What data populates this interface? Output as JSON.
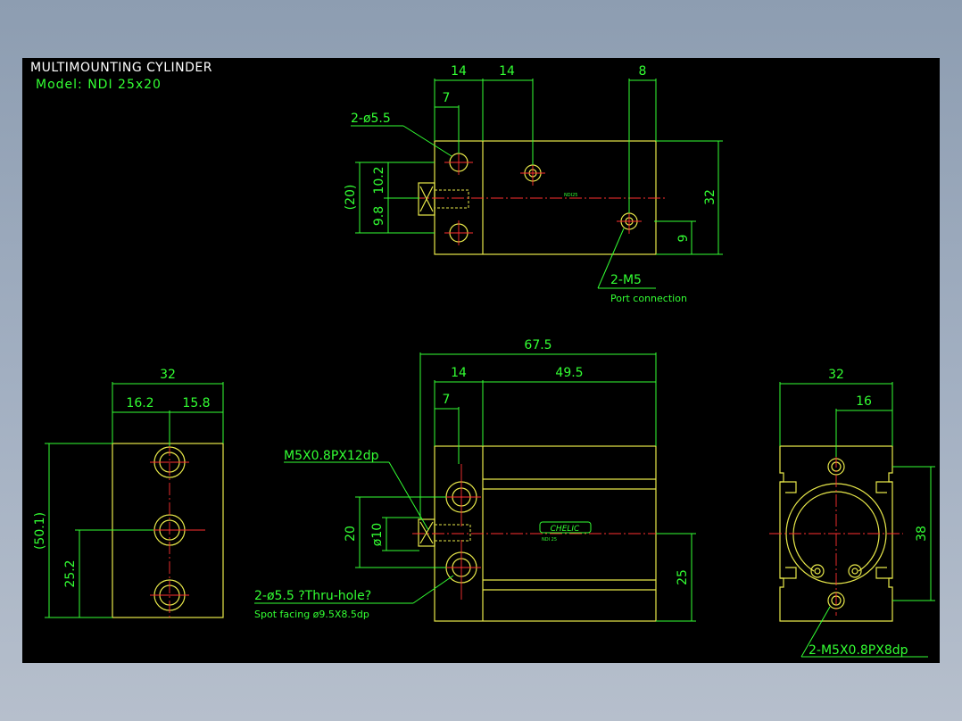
{
  "header": {
    "title": "MULTIMOUNTING CYLINDER",
    "model": "Model: NDI 25x20"
  },
  "top_view": {
    "dim_14a": "14",
    "dim_14b": "14",
    "dim_8": "8",
    "dim_7": "7",
    "dim_hole": "2-ø5.5",
    "dim_20": "(20)",
    "dim_10_2": "10.2",
    "dim_9_8": "9.8",
    "dim_32": "32",
    "dim_9": "9",
    "port_label": "2-M5",
    "port_desc": "Port connection",
    "tiny_label": "NDI25"
  },
  "side_view": {
    "dim_32": "32",
    "dim_16_2": "16.2",
    "dim_15_8": "15.8",
    "dim_50_1": "(50.1)",
    "dim_25_2": "25.2"
  },
  "front_view": {
    "dim_67_5": "67.5",
    "dim_14": "14",
    "dim_49_5": "49.5",
    "dim_7": "7",
    "thread_label": "M5X0.8PX12dp",
    "dim_20": "20",
    "dim_phi10": "ø10",
    "dim_25": "25",
    "hole_label": "2-ø5.5 ?Thru-hole?",
    "spot_label": "Spot facing ø9.5X8.5dp",
    "logo": "CHELIC",
    "logo_sub": "NDI 25"
  },
  "end_view": {
    "dim_32": "32",
    "dim_16": "16",
    "dim_38": "38",
    "thread_label": "2-M5X0.8PX8dp"
  },
  "colors": {
    "background": "#000000",
    "frame": "#8d9db1",
    "dimension": "#33ff33",
    "outline": "#e8e84a",
    "centerline": "#ff3030",
    "title": "#ffffff"
  }
}
